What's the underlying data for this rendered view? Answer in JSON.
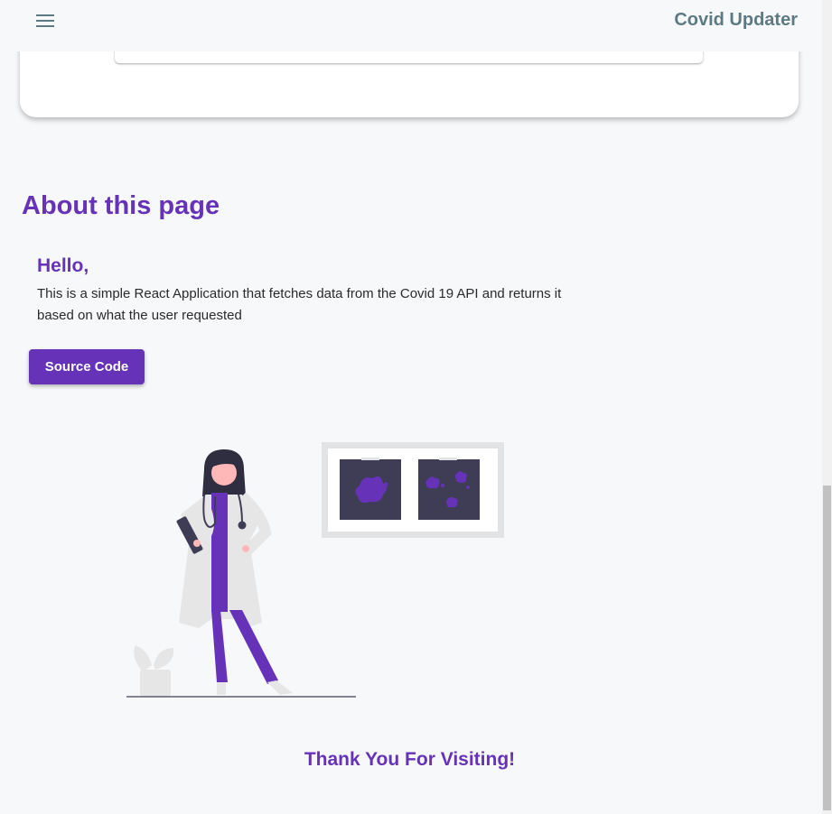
{
  "appbar": {
    "title": "Covid Updater",
    "menu_icon": "hamburger-menu-icon"
  },
  "about": {
    "heading": "About this page",
    "greeting": "Hello,",
    "description": "This is a simple React Application that fetches data from the Covid 19 API and returns it based on what the user requested",
    "source_button_label": "Source Code"
  },
  "illustration": {
    "name": "doctor-with-xray-illustration"
  },
  "footer": {
    "thanks": "Thank You For Visiting!"
  },
  "colors": {
    "accent": "#6633b8",
    "title": "#5d7a82",
    "background": "#f7f8fa"
  }
}
